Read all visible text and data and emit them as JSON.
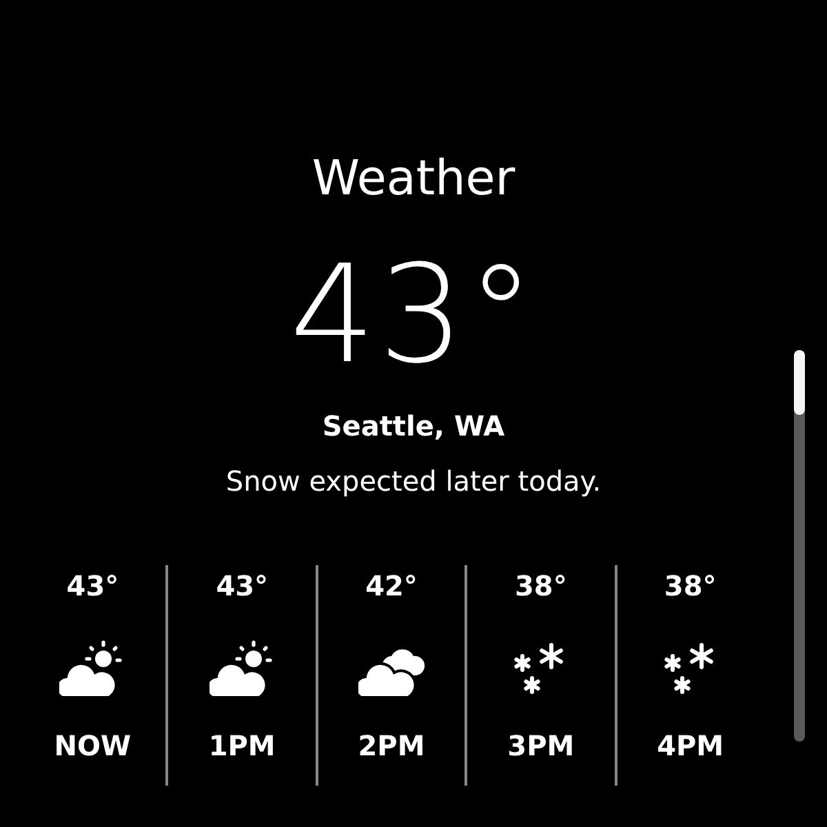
{
  "title": "Weather",
  "temperature": "43°",
  "location": "Seattle, WA",
  "summary": "Snow expected later today.",
  "hourly": [
    {
      "temp": "43°",
      "kind": "partlysunny",
      "time": "NOW"
    },
    {
      "temp": "43°",
      "kind": "partlysunny",
      "time": "1PM"
    },
    {
      "temp": "42°",
      "kind": "cloudy",
      "time": "2PM"
    },
    {
      "temp": "38°",
      "kind": "snow",
      "time": "3PM"
    },
    {
      "temp": "38°",
      "kind": "snow",
      "time": "4PM"
    }
  ]
}
